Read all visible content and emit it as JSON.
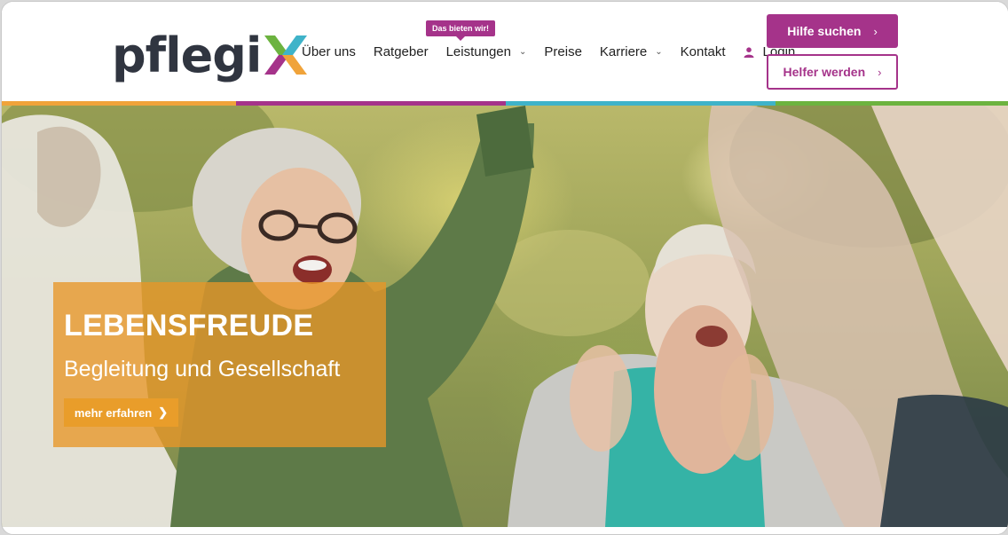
{
  "brand": {
    "logo_text": "pflegi",
    "logo_letter": "X"
  },
  "nav": {
    "badge": "Das bieten wir!",
    "items": [
      {
        "label": "Über uns",
        "has_dropdown": false
      },
      {
        "label": "Ratgeber",
        "has_dropdown": false
      },
      {
        "label": "Leistungen",
        "has_dropdown": true
      },
      {
        "label": "Preise",
        "has_dropdown": false
      },
      {
        "label": "Karriere",
        "has_dropdown": true
      },
      {
        "label": "Kontakt",
        "has_dropdown": false
      }
    ],
    "login_label": "Login",
    "login_icon": "user-icon"
  },
  "actions": {
    "primary_label": "Hilfe suchen",
    "secondary_label": "Helfer werden"
  },
  "hero": {
    "title": "LEBENSFREUDE",
    "subtitle": "Begleitung und Gesellschaft",
    "button_label": "mehr erfahren"
  },
  "colors": {
    "brand_purple": "#a5338a",
    "orange": "#e99d2a",
    "stripe_orange": "#f0a33a",
    "stripe_purple": "#a5338a",
    "stripe_teal": "#3fb3c9",
    "stripe_green": "#6cb33f",
    "text_dark": "#303540"
  }
}
